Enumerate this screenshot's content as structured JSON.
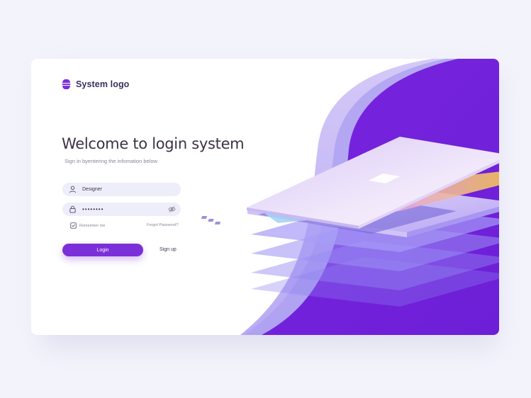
{
  "brand": {
    "logo_text": "System logo",
    "accent": "#7b2fd8"
  },
  "login": {
    "title": "Welcome to login system",
    "subtitle": "Sign in byentering the infomation below",
    "username": {
      "value": "Designer",
      "icon": "user-icon"
    },
    "password": {
      "value": "••••••••",
      "icon": "lock-icon",
      "toggle_icon": "eye-off-icon"
    },
    "remember_label": "Remember me",
    "forgot_label": "Forgot Password?",
    "login_label": "Login",
    "signup_label": "Sign up"
  },
  "illustration": {
    "icon": "laptop-illustration"
  }
}
